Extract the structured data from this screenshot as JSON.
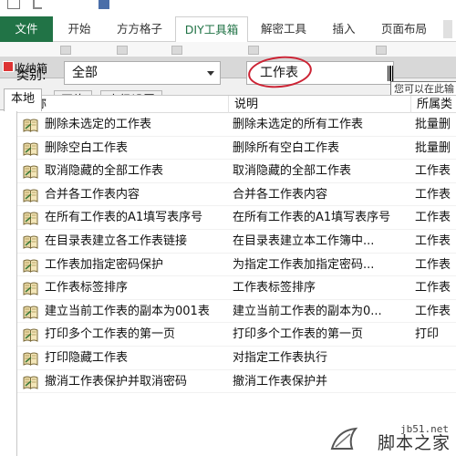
{
  "ribbon_tabs": [
    {
      "label": "文件"
    },
    {
      "label": "开始"
    },
    {
      "label": "方方格子"
    },
    {
      "label": "DIY工具箱"
    },
    {
      "label": "解密工具"
    },
    {
      "label": "插入"
    },
    {
      "label": "页面布局"
    }
  ],
  "dialog": {
    "title": "收纳箱",
    "tabs": [
      "本地",
      "网络",
      "高级设置"
    ],
    "active_tab": "本地",
    "category_label": "类别:",
    "category_value": "全部",
    "search_value": "工作表",
    "tooltip": "您可以在此输"
  },
  "list": {
    "columns": [
      "名称",
      "说明",
      "所属类"
    ],
    "rows": [
      {
        "name": "删除未选定的工作表",
        "desc": "删除未选定的所有工作表",
        "type": "批量删"
      },
      {
        "name": "删除空白工作表",
        "desc": "删除所有空白工作表",
        "type": "批量删"
      },
      {
        "name": "取消隐藏的全部工作表",
        "desc": "取消隐藏的全部工作表",
        "type": "工作表"
      },
      {
        "name": "合并各工作表内容",
        "desc": "合并各工作表内容",
        "type": "工作表"
      },
      {
        "name": "在所有工作表的A1填写表序号",
        "desc": "在所有工作表的A1填写表序号",
        "type": "工作表"
      },
      {
        "name": "在目录表建立各工作表链接",
        "desc": "在目录表建立本工作簿中...",
        "type": "工作表"
      },
      {
        "name": "工作表加指定密码保护",
        "desc": "为指定工作表加指定密码...",
        "type": "工作表"
      },
      {
        "name": "工作表标签排序",
        "desc": "工作表标签排序",
        "type": "工作表"
      },
      {
        "name": "建立当前工作表的副本为001表",
        "desc": "建立当前工作表的副本为0...",
        "type": "工作表"
      },
      {
        "name": "打印多个工作表的第一页",
        "desc": "打印多个工作表的第一页",
        "type": "打印"
      },
      {
        "name": "打印隐藏工作表",
        "desc": "对指定工作表执行",
        "type": ""
      },
      {
        "name": "撤消工作表保护并取消密码",
        "desc": "撤消工作表保护并",
        "type": ""
      }
    ]
  },
  "watermark": {
    "url": "jb51.net",
    "text": "脚本之家"
  },
  "colors": {
    "file_tab": "#217346",
    "annotation_circle": "#cc2233"
  }
}
